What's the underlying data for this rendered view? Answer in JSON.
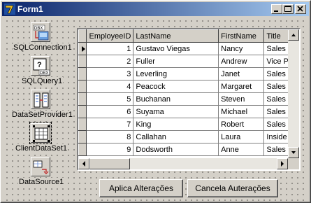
{
  "window": {
    "title": "Form1",
    "icon": "delphi-icon"
  },
  "title_buttons": [
    "minimize-icon",
    "maximize-icon",
    "close-icon"
  ],
  "components": [
    {
      "label": "SQLConnection1",
      "icon": "sql-connection-icon",
      "icon_text": "DBX"
    },
    {
      "label": "SQLQuery1",
      "icon": "sql-query-icon",
      "icon_text": "DBX"
    },
    {
      "label": "DataSetProvider1",
      "icon": "dataset-provider-icon"
    },
    {
      "label": "ClientDataSet1",
      "icon": "client-dataset-icon"
    },
    {
      "label": "DataSource1",
      "icon": "datasource-icon"
    }
  ],
  "grid": {
    "columns": [
      "EmployeeID",
      "LastName",
      "FirstName",
      "Title"
    ],
    "rows": [
      [
        "1",
        "Gustavo Viegas",
        "Nancy",
        "Sales R"
      ],
      [
        "2",
        "Fuller",
        "Andrew",
        "Vice P"
      ],
      [
        "3",
        "Leverling",
        "Janet",
        "Sales R"
      ],
      [
        "4",
        "Peacock",
        "Margaret",
        "Sales R"
      ],
      [
        "5",
        "Buchanan",
        "Steven",
        "Sales M"
      ],
      [
        "6",
        "Suyama",
        "Michael",
        "Sales R"
      ],
      [
        "7",
        "King",
        "Robert",
        "Sales R"
      ],
      [
        "8",
        "Callahan",
        "Laura",
        "Inside"
      ],
      [
        "9",
        "Dodsworth",
        "Anne",
        "Sales R"
      ]
    ],
    "current_row": 0
  },
  "buttons": {
    "apply": "Aplica Alterações",
    "cancel": "Cancela Auterações"
  }
}
